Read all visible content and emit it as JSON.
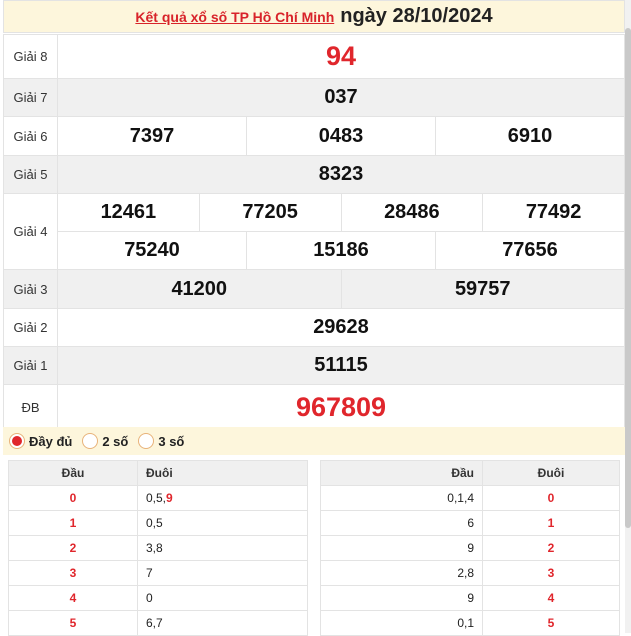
{
  "header": {
    "link_text": "Kết quả xổ số TP Hồ Chí Minh",
    "date_text": "ngày 28/10/2024"
  },
  "prizes": {
    "g8": {
      "label": "Giải 8",
      "numbers": [
        "94"
      ]
    },
    "g7": {
      "label": "Giải 7",
      "numbers": [
        "037"
      ]
    },
    "g6": {
      "label": "Giải 6",
      "numbers": [
        "7397",
        "0483",
        "6910"
      ]
    },
    "g5": {
      "label": "Giải 5",
      "numbers": [
        "8323"
      ]
    },
    "g4": {
      "label": "Giải 4",
      "numbers": [
        "12461",
        "77205",
        "28486",
        "77492",
        "75240",
        "15186",
        "77656"
      ]
    },
    "g3": {
      "label": "Giải 3",
      "numbers": [
        "41200",
        "59757"
      ]
    },
    "g2": {
      "label": "Giải 2",
      "numbers": [
        "29628"
      ]
    },
    "g1": {
      "label": "Giải 1",
      "numbers": [
        "51115"
      ]
    },
    "db": {
      "label": "ĐB",
      "numbers": [
        "967809"
      ]
    }
  },
  "options": {
    "selected": "full",
    "full_label": "Đầy đủ",
    "two_label": "2 số",
    "three_label": "3 số"
  },
  "dau_duoi_left": {
    "col_head": "Đầu",
    "col_tail": "Đuôi",
    "rows": [
      {
        "head": "0",
        "tail": "0,5,",
        "tail_hl": "9"
      },
      {
        "head": "1",
        "tail": "0,5",
        "tail_hl": ""
      },
      {
        "head": "2",
        "tail": "3,8",
        "tail_hl": ""
      },
      {
        "head": "3",
        "tail": "7",
        "tail_hl": ""
      },
      {
        "head": "4",
        "tail": "0",
        "tail_hl": ""
      },
      {
        "head": "5",
        "tail": "6,7",
        "tail_hl": ""
      }
    ]
  },
  "dau_duoi_right": {
    "col_head": "Đầu",
    "col_tail": "Đuôi",
    "rows": [
      {
        "head": "0,1,4",
        "tail": "0"
      },
      {
        "head": "6",
        "tail": "1"
      },
      {
        "head": "9",
        "tail": "2"
      },
      {
        "head": "2,8",
        "tail": "3"
      },
      {
        "head": "9",
        "tail": "4"
      },
      {
        "head": "0,1",
        "tail": "5"
      }
    ]
  },
  "colors": {
    "accent_red": "#e0262c",
    "header_bg": "#fdf6dc"
  }
}
